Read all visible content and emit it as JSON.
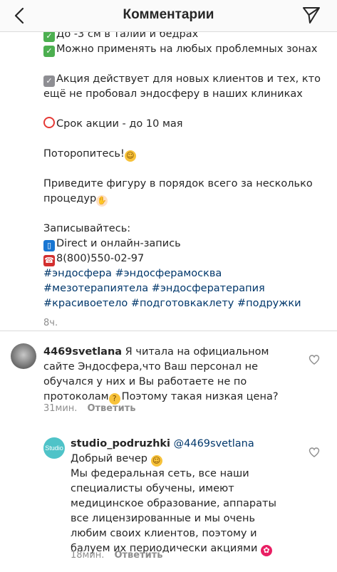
{
  "header": {
    "title": "Комментарии",
    "back_icon": "chevron-left-icon",
    "send_icon": "paper-plane-icon"
  },
  "caption": {
    "line1": "До -3 см в талии и бедрах",
    "line2": "Можно применять на любых проблемных зонах",
    "line3": "Акция действует для новых клиентов и тех, кто",
    "line4": "ещё не пробовал эндосферу в наших клиниках",
    "line5": "Срок акции - до 10 мая",
    "line6": "Поторопитесь!",
    "line7": "Приведите фигуру в порядок всего за несколько",
    "line8": "процедур",
    "line9": "Записывайтесь:",
    "line10": "Direct и онлайн-запись",
    "line11": "8(800)550-02-97",
    "hashtags_line1": "#эндосфера #эндосферамосква",
    "hashtags_line2": "#мезотерапиятела #эндосфератерапия",
    "hashtags_line3": "#красивоетело #подготовкаклету #подружки",
    "timestamp": "8ч."
  },
  "comments": [
    {
      "username": "4469svetlana",
      "line1": " Я читала на официальном",
      "line2": "сайте Эндосфера,что Ваш персонал не",
      "line3": "обучался у них и Вы работаете не по",
      "line4a": "протоколам",
      "line4b": "Поэтому такая низкая цена?",
      "time": "31мин.",
      "reply": "Ответить"
    }
  ],
  "reply": {
    "username": "studio_podruzhki",
    "mention": " @4469svetlana",
    "avatar_label": "Studio",
    "line1": "Добрый вечер",
    "line2": "Мы федеральная сеть, все наши",
    "line3": "специалисты обучены, имеют",
    "line4": "медицинское образование, аппараты",
    "line5": "все лицензированные и мы очень",
    "line6": "любим своих клиентов, поэтому и",
    "line7": "балуем их периодически акциями",
    "time": "18мин.",
    "reply_label": "Ответить"
  },
  "colors": {
    "hashtag": "#00376b",
    "meta": "#8e8e8e",
    "text": "#262626"
  }
}
